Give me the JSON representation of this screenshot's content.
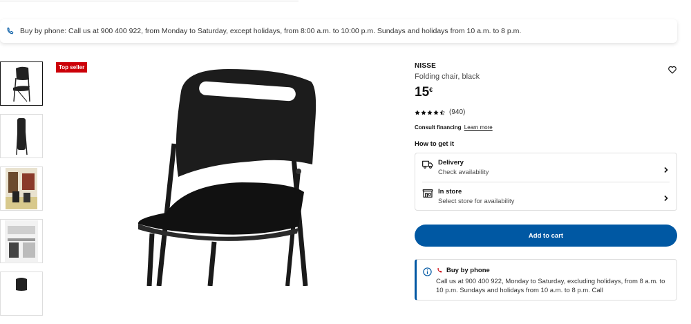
{
  "banner": {
    "phone_text": "Buy by phone: Call us at 900 400 922, from Monday to Saturday, except holidays, from 8:00 a.m. to 10:00 p.m. Sundays and holidays from 10 a.m. to 8 p.m."
  },
  "gallery": {
    "badge": "Top seller"
  },
  "product": {
    "name": "NISSE",
    "description": "Folding chair, black",
    "price": "15",
    "currency": "€",
    "rating_value": 4.5,
    "review_count": "(940)",
    "financing_label": "Consult financing",
    "financing_link": "Learn more"
  },
  "fulfilment": {
    "heading": "How to get it",
    "delivery_title": "Delivery",
    "delivery_sub": "Check availability",
    "store_title": "In store",
    "store_sub": "Select store for availability"
  },
  "cart": {
    "label": "Add to cart"
  },
  "phone_box": {
    "title": "Buy by phone",
    "body": "Call us at 900 400 922, Monday to Saturday, excluding holidays, from 8 a.m. to 10 p.m. Sundays and holidays from 10 a.m. to 8 p.m. Call"
  },
  "colors": {
    "accent": "#0058a3",
    "badge": "#cc0008"
  }
}
